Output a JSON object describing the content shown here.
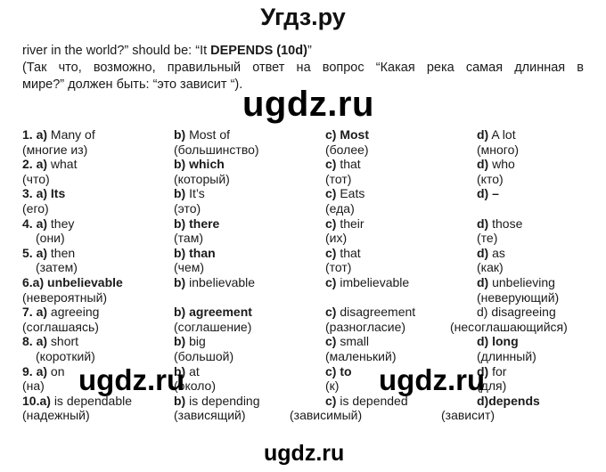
{
  "header": {
    "site_title": "Угдз.ру"
  },
  "intro": {
    "line1_prefix": "river in the world?” should be: “It ",
    "line1_bold": "DEPENDS (10d)",
    "line1_suffix": "”",
    "line2": "(Так что, возможно, правильный ответ на вопрос “Какая река самая длинная в",
    "line3": "мире?” должен быть: “это зависит “)."
  },
  "watermarks": {
    "main": "ugdz.ru",
    "mid_left": "ugdz.ru",
    "mid_right": "ugdz.ru",
    "bottom": "ugdz.ru"
  },
  "questions": [
    {
      "num": "1. a)",
      "options": [
        {
          "letter": "a)",
          "text": "Many of",
          "bold": false,
          "translation": "(многие из)"
        },
        {
          "letter": "b)",
          "text": "Most of",
          "bold": false,
          "translation": "(большинство)"
        },
        {
          "letter": "c)",
          "text": "Most",
          "bold": true,
          "translation": "(более)"
        },
        {
          "letter": "d)",
          "text": "A lot",
          "bold": false,
          "translation": "(много)"
        }
      ]
    },
    {
      "num": "2. a)",
      "options": [
        {
          "letter": "a)",
          "text": "what",
          "bold": false,
          "translation": "(что)"
        },
        {
          "letter": "b)",
          "text": "which",
          "bold": true,
          "translation": "(который)"
        },
        {
          "letter": "c)",
          "text": "that",
          "bold": false,
          "translation": "(тот)"
        },
        {
          "letter": "d)",
          "text": "who",
          "bold": false,
          "translation": "(кто)"
        }
      ]
    },
    {
      "num": "3. a)",
      "options": [
        {
          "letter": "a)",
          "text": "Its",
          "bold": true,
          "translation": "(его)"
        },
        {
          "letter": "b)",
          "text": "It’s",
          "bold": false,
          "translation": "(это)"
        },
        {
          "letter": "c)",
          "text": "Eats",
          "bold": false,
          "translation": "(еда)"
        },
        {
          "letter": "d)",
          "text": "–",
          "bold": true,
          "translation": ""
        }
      ]
    },
    {
      "num": "4. a)",
      "options": [
        {
          "letter": "a)",
          "text": "they",
          "bold": false,
          "translation": "(они)"
        },
        {
          "letter": "b)",
          "text": "there",
          "bold": true,
          "translation": "(там)"
        },
        {
          "letter": "c)",
          "text": "their",
          "bold": false,
          "translation": "(их)"
        },
        {
          "letter": "d)",
          "text": "those",
          "bold": false,
          "translation": "(те)"
        }
      ]
    },
    {
      "num": "5. a)",
      "options": [
        {
          "letter": "a)",
          "text": "then",
          "bold": false,
          "translation": "(затем)"
        },
        {
          "letter": "b)",
          "text": "than",
          "bold": true,
          "translation": "(чем)"
        },
        {
          "letter": "c)",
          "text": "that",
          "bold": false,
          "translation": "(тот)"
        },
        {
          "letter": "d)",
          "text": "as",
          "bold": false,
          "translation": "(как)"
        }
      ]
    },
    {
      "num": "6.a)",
      "options": [
        {
          "letter": "a)",
          "text": "unbelievable",
          "bold": true,
          "translation": "(невероятный)"
        },
        {
          "letter": "b)",
          "text": "inbelievable",
          "bold": false,
          "translation": ""
        },
        {
          "letter": "c)",
          "text": "imbelievable",
          "bold": false,
          "translation": ""
        },
        {
          "letter": "d)",
          "text": "unbelieving",
          "bold": false,
          "translation": "(неверующий)"
        }
      ]
    },
    {
      "num": "7. a)",
      "options": [
        {
          "letter": "a)",
          "text": "agreeing",
          "bold": false,
          "translation": "(соглашаясь)"
        },
        {
          "letter": "b)",
          "text": "agreement",
          "bold": true,
          "translation": "(соглашение)"
        },
        {
          "letter": "c)",
          "text": "disagreement",
          "bold": false,
          "translation": "(разногласие)"
        },
        {
          "letter": "d)",
          "text": "disagreeing",
          "bold": false,
          "translation": "(несоглашающийся)"
        }
      ]
    },
    {
      "num": "8. a)",
      "options": [
        {
          "letter": "a)",
          "text": "short",
          "bold": false,
          "translation": "(короткий)"
        },
        {
          "letter": "b)",
          "text": "big",
          "bold": false,
          "translation": "(большой)"
        },
        {
          "letter": "c)",
          "text": "small",
          "bold": false,
          "translation": "(маленький)"
        },
        {
          "letter": "d)",
          "text": "long",
          "bold": true,
          "translation": "(длинный)"
        }
      ]
    },
    {
      "num": "9. a)",
      "options": [
        {
          "letter": "a)",
          "text": "on",
          "bold": false,
          "translation": "(на)"
        },
        {
          "letter": "b)",
          "text": "at",
          "bold": false,
          "translation": "(около)"
        },
        {
          "letter": "c)",
          "text": "to",
          "bold": true,
          "translation": "(к)"
        },
        {
          "letter": "d)",
          "text": "for",
          "bold": false,
          "translation": "(для)"
        }
      ]
    },
    {
      "num": "10.a)",
      "options": [
        {
          "letter": "a)",
          "text": "is dependable",
          "bold": false,
          "translation": "(надежный)"
        },
        {
          "letter": "b)",
          "text": "is depending",
          "bold": false,
          "translation": "(зависящий)"
        },
        {
          "letter": "c)",
          "text": "is depended",
          "bold": false,
          "translation": "(зависимый)"
        },
        {
          "letter": "d)",
          "text": "depends",
          "bold": true,
          "translation": "(зависит)"
        }
      ]
    }
  ]
}
